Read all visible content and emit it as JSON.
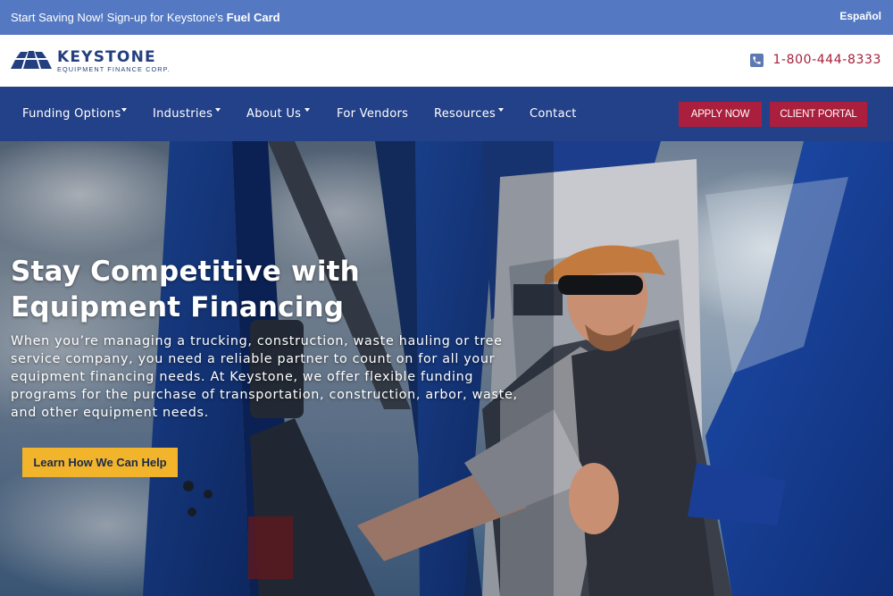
{
  "topbar": {
    "promo_prefix": "Start Saving Now! Sign-up for Keystone's ",
    "promo_link": "Fuel Card",
    "language_link": "Español"
  },
  "header": {
    "logo": {
      "brand": "KEYSTONE",
      "tagline": "EQUIPMENT FINANCE CORP."
    },
    "phone": "1-800-444-8333"
  },
  "nav": {
    "items": [
      {
        "label": "Funding Options",
        "has_dropdown": true
      },
      {
        "label": "Industries",
        "has_dropdown": true
      },
      {
        "label": "About Us",
        "has_dropdown": true
      },
      {
        "label": "For Vendors",
        "has_dropdown": false
      },
      {
        "label": "Resources",
        "has_dropdown": true
      },
      {
        "label": "Contact",
        "has_dropdown": false
      }
    ],
    "apply_label": "APPLY NOW",
    "portal_label": "CLIENT PORTAL"
  },
  "hero": {
    "title": "Stay Competitive with Equipment Financing",
    "description": "When you’re managing a trucking, construction, waste hauling or tree service company, you need a reliable partner to count on for all your equipment financing needs. At Keystone, we offer flexible funding programs for the purchase of transportation, construction, arbor, waste, and other equipment needs.",
    "cta_label": "Learn How We Can Help"
  },
  "colors": {
    "topbar": "#5479c2",
    "nav": "#234189",
    "brand_blue": "#233f80",
    "accent_red": "#aa1f3d",
    "cta_yellow": "#f1b42a",
    "phone_red": "#a6203a"
  },
  "icons": {
    "logo_mark": "keystone-arch-icon",
    "phone": "phone-icon",
    "dropdown": "caret-down-icon"
  }
}
